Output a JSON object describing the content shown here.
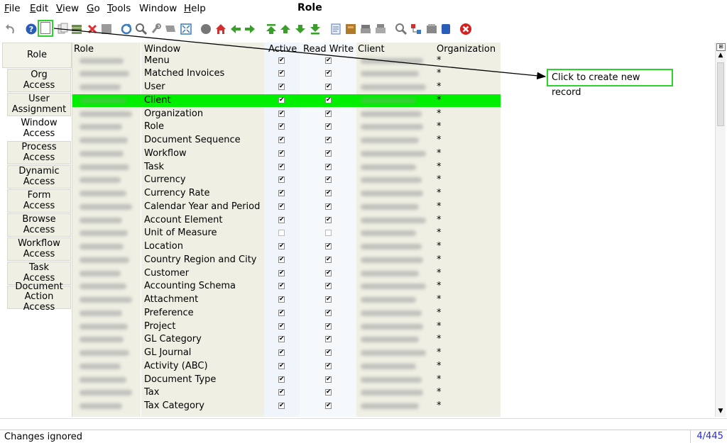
{
  "menu": [
    {
      "label": "File",
      "mnemonic": "F",
      "rest": "ile"
    },
    {
      "label": "Edit",
      "mnemonic": "E",
      "rest": "dit"
    },
    {
      "label": "View",
      "mnemonic": "V",
      "rest": "iew"
    },
    {
      "label": "Go",
      "mnemonic": "G",
      "rest": "o"
    },
    {
      "label": "Tools",
      "mnemonic": "T",
      "rest": "ools"
    },
    {
      "label": "Window",
      "mnemonic": "",
      "rest": "Window"
    },
    {
      "label": "Help",
      "mnemonic": "H",
      "rest": "elp"
    }
  ],
  "window_title": "Role",
  "toolbar": {
    "icons": [
      "undo-icon",
      "help-icon",
      "new-record-icon",
      "copy-record-icon",
      "save-icon",
      "delete-icon",
      "delete-selection-icon",
      "refresh-icon",
      "find-icon",
      "attachment-icon",
      "chat-icon",
      "grid-toggle-icon",
      "history-icon",
      "home-icon",
      "parent-record-icon",
      "detail-record-icon",
      "first-record-icon",
      "previous-record-icon",
      "next-record-icon",
      "last-record-icon",
      "report-icon",
      "archive-icon",
      "print-preview-icon",
      "print-icon",
      "zoom-across-icon",
      "workflow-icon",
      "product-info-icon",
      "request-icon",
      "close-window-icon"
    ],
    "colors": {
      "highlight": "#2bd32b",
      "close": "#d81e1e",
      "nav_green": "#3a9e2a"
    }
  },
  "tabs": [
    {
      "label": "Role",
      "selected": false
    },
    {
      "label": "Org Access",
      "line1": "Org",
      "line2": "Access"
    },
    {
      "label": "User Assignment",
      "line1": "User",
      "line2": "Assignment"
    },
    {
      "label": "Window Access",
      "line1": "Window",
      "line2": "Access",
      "selected": true
    },
    {
      "label": "Process Access",
      "line1": "Process",
      "line2": "Access"
    },
    {
      "label": "Dynamic Access",
      "line1": "Dynamic",
      "line2": "Access"
    },
    {
      "label": "Form Access",
      "line1": "Form",
      "line2": "Access"
    },
    {
      "label": "Browse Access",
      "line1": "Browse",
      "line2": "Access"
    },
    {
      "label": "Workflow Access",
      "line1": "Workflow",
      "line2": "Access"
    },
    {
      "label": "Task Access",
      "line1": "Task",
      "line2": "Access"
    },
    {
      "label": "Document Action Access",
      "line1": "Document",
      "line2": "Action Access"
    }
  ],
  "grid": {
    "columns": {
      "role": "Role",
      "window": "Window",
      "active": "Active",
      "read_write": "Read Write",
      "client": "Client",
      "organization": "Organization"
    },
    "rows": [
      {
        "window": "Menu",
        "active": true,
        "read_write": true,
        "org": "*"
      },
      {
        "window": "Matched Invoices",
        "active": true,
        "read_write": true,
        "org": "*"
      },
      {
        "window": "User",
        "active": true,
        "read_write": true,
        "org": "*"
      },
      {
        "window": "Client",
        "active": true,
        "read_write": true,
        "org": "*",
        "selected": true
      },
      {
        "window": "Organization",
        "active": true,
        "read_write": true,
        "org": "*"
      },
      {
        "window": "Role",
        "active": true,
        "read_write": true,
        "org": "*"
      },
      {
        "window": "Document Sequence",
        "active": true,
        "read_write": true,
        "org": "*"
      },
      {
        "window": "Workflow",
        "active": true,
        "read_write": true,
        "org": "*"
      },
      {
        "window": "Task",
        "active": true,
        "read_write": true,
        "org": "*"
      },
      {
        "window": "Currency",
        "active": true,
        "read_write": true,
        "org": "*"
      },
      {
        "window": "Currency Rate",
        "active": true,
        "read_write": true,
        "org": "*"
      },
      {
        "window": "Calendar Year and Period",
        "active": true,
        "read_write": true,
        "org": "*"
      },
      {
        "window": "Account Element",
        "active": true,
        "read_write": true,
        "org": "*"
      },
      {
        "window": "Unit of Measure",
        "active": false,
        "read_write": false,
        "org": "*"
      },
      {
        "window": "Location",
        "active": true,
        "read_write": true,
        "org": "*"
      },
      {
        "window": "Country Region and City",
        "active": true,
        "read_write": true,
        "org": "*"
      },
      {
        "window": "Customer",
        "active": true,
        "read_write": true,
        "org": "*"
      },
      {
        "window": "Accounting Schema",
        "active": true,
        "read_write": true,
        "org": "*"
      },
      {
        "window": "Attachment",
        "active": true,
        "read_write": true,
        "org": "*"
      },
      {
        "window": "Preference",
        "active": true,
        "read_write": true,
        "org": "*"
      },
      {
        "window": "Project",
        "active": true,
        "read_write": true,
        "org": "*"
      },
      {
        "window": "GL Category",
        "active": true,
        "read_write": true,
        "org": "*"
      },
      {
        "window": "GL Journal",
        "active": true,
        "read_write": true,
        "org": "*"
      },
      {
        "window": "Activity (ABC)",
        "active": true,
        "read_write": true,
        "org": "*"
      },
      {
        "window": "Document Type",
        "active": true,
        "read_write": true,
        "org": "*"
      },
      {
        "window": "Tax",
        "active": true,
        "read_write": true,
        "org": "*"
      },
      {
        "window": "Tax Category",
        "active": true,
        "read_write": true,
        "org": "*"
      }
    ],
    "selection_color": "#00ee00"
  },
  "callout": {
    "text": "Click to create new record"
  },
  "status": {
    "text": "Changes ignored",
    "record_count": "4/445"
  }
}
